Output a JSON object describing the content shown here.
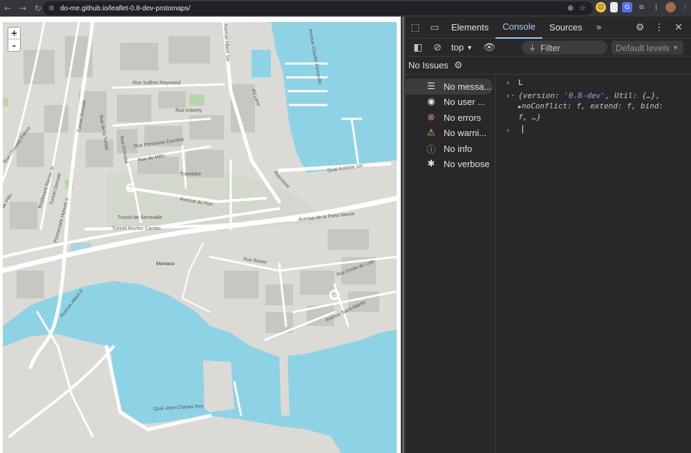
{
  "browser": {
    "url": "do-me.github.io/leaflet-0.8-dev-protomaps/",
    "nav_back": "←",
    "nav_forward": "→",
    "nav_reload": "↻"
  },
  "map": {
    "zoom_in": "+",
    "zoom_out": "-",
    "colors": {
      "land": "#dcdad5",
      "water": "#8ed3e5",
      "road": "#ffffff",
      "park": "#b8d6ab"
    },
    "labels": [
      "Rue Suffren Reymond",
      "Rue Imberty",
      "Rue Princesse Caroline",
      "Rue de Millo",
      "Rue Grimaldi",
      "Rue de la Turbie",
      "Tunnel Dorsale",
      "Boulevard Rainier III",
      "Tunnel Dorsale",
      "Promenade Honoré II",
      "Travolator",
      "Avenue du Port",
      "Tunnel de Serravalle",
      "Tunnel Rocher Canton",
      "Avenue de la Porte Neuve",
      "Monaco",
      "Rue Basse",
      "Rue Emile de Loth",
      "Avenue Saint-Martin",
      "Avenue Albert II",
      "Quai Jean-Charles Rey",
      "Quai Antoine 1er",
      "Rascasse",
      "Pil Lane",
      "Avenue Albert 1er",
      "Avenue Claudio Fornaville",
      "Rue Crovetto Frères",
      "de Piliu"
    ]
  },
  "devtools": {
    "tabs": [
      "Elements",
      "Console",
      "Sources"
    ],
    "active_tab": "Console",
    "context": "top",
    "filter_placeholder": "Filter",
    "levels": "Default levels",
    "issues": "No Issues",
    "sidebar": [
      {
        "label": "No messa...",
        "icon": "list-icon"
      },
      {
        "label": "No user ...",
        "icon": "user-icon"
      },
      {
        "label": "No errors",
        "icon": "error-icon"
      },
      {
        "label": "No warni...",
        "icon": "warning-icon"
      },
      {
        "label": "No info",
        "icon": "info-icon"
      },
      {
        "label": "No verbose",
        "icon": "bug-icon"
      }
    ],
    "console": {
      "input_line": "L",
      "result_line1_pre": "{version: ",
      "result_version": "'0.8-dev'",
      "result_line1_post": ", Util: {…},",
      "result_line2": "noConflict: f, extend: f, bind:",
      "result_line3": "f, …}"
    }
  }
}
